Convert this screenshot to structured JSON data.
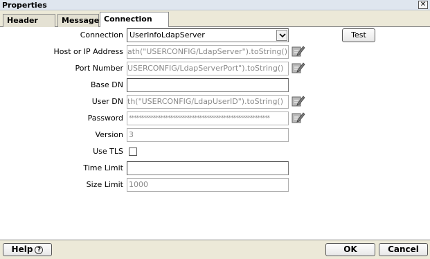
{
  "window": {
    "title": "Properties",
    "close_glyph": "✕"
  },
  "tabs": [
    {
      "label": "Header Info"
    },
    {
      "label": "Messages"
    },
    {
      "label": "Connection Info",
      "active": true
    }
  ],
  "form": {
    "connection": {
      "label": "Connection",
      "value": "UserInfoLdapServer"
    },
    "host": {
      "label": "Host or IP Address",
      "value": "ath(\"USERCONFIG/LdapServer\").toString()"
    },
    "port": {
      "label": "Port Number",
      "value": "USERCONFIG/LdapServerPort\").toString()"
    },
    "base_dn": {
      "label": "Base DN",
      "value": ""
    },
    "user_dn": {
      "label": "User DN",
      "value": "th(\"USERCONFIG/LdapUserID\").toString()"
    },
    "password": {
      "label": "Password",
      "value": "**********************************************************"
    },
    "version": {
      "label": "Version",
      "value": "3"
    },
    "use_tls": {
      "label": "Use TLS",
      "checked": false
    },
    "time_limit": {
      "label": "Time Limit",
      "value": ""
    },
    "size_limit": {
      "label": "Size Limit",
      "value": "1000"
    }
  },
  "buttons": {
    "test": "Test",
    "help": "Help",
    "help_glyph": "?",
    "ok": "OK",
    "cancel": "Cancel"
  },
  "icons": {
    "dropdown": "chevron-down-icon",
    "edit": "edit-expression-icon",
    "close": "close-icon",
    "help": "question-icon"
  }
}
